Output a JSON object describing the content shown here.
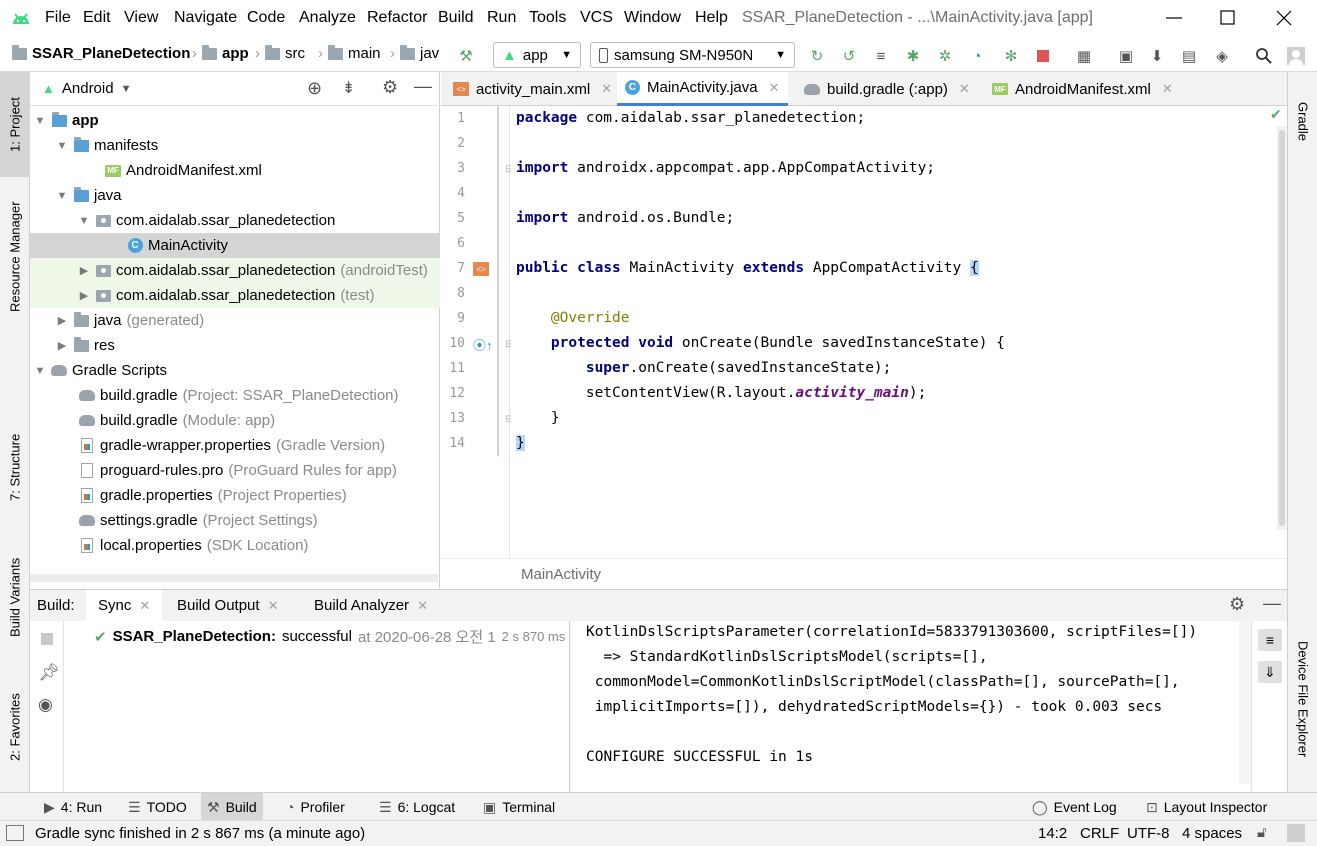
{
  "menu": {
    "items": [
      "File",
      "Edit",
      "View",
      "Navigate",
      "Code",
      "Analyze",
      "Refactor",
      "Build",
      "Run",
      "Tools",
      "VCS",
      "Window",
      "Help"
    ],
    "window_title": "SSAR_PlaneDetection - ...\\MainActivity.java [app]"
  },
  "nav": {
    "crumbs": [
      "SSAR_PlaneDetection",
      "app",
      "src",
      "main",
      "jav"
    ],
    "run_config": "app",
    "device": "samsung SM-N950N"
  },
  "left_strip": {
    "project": "1: Project",
    "resource_manager": "Resource Manager",
    "structure": "7: Structure",
    "build_variants": "Build Variants",
    "favorites": "2: Favorites"
  },
  "right_strip": {
    "gradle": "Gradle",
    "device_file_explorer": "Device File Explorer"
  },
  "project": {
    "view_mode": "Android",
    "tree": [
      {
        "label": "app",
        "muted": "",
        "bold": true
      },
      {
        "label": "manifests",
        "muted": ""
      },
      {
        "label": "AndroidManifest.xml",
        "muted": ""
      },
      {
        "label": "java",
        "muted": ""
      },
      {
        "label": "com.aidalab.ssar_planedetection",
        "muted": ""
      },
      {
        "label": "MainActivity",
        "muted": ""
      },
      {
        "label": "com.aidalab.ssar_planedetection",
        "muted": "(androidTest)"
      },
      {
        "label": "com.aidalab.ssar_planedetection",
        "muted": "(test)"
      },
      {
        "label": "java",
        "muted": "(generated)"
      },
      {
        "label": "res",
        "muted": ""
      },
      {
        "label": "Gradle Scripts",
        "muted": ""
      },
      {
        "label": "build.gradle",
        "muted": "(Project: SSAR_PlaneDetection)"
      },
      {
        "label": "build.gradle",
        "muted": "(Module: app)"
      },
      {
        "label": "gradle-wrapper.properties",
        "muted": "(Gradle Version)"
      },
      {
        "label": "proguard-rules.pro",
        "muted": "(ProGuard Rules for app)"
      },
      {
        "label": "gradle.properties",
        "muted": "(Project Properties)"
      },
      {
        "label": "settings.gradle",
        "muted": "(Project Settings)"
      },
      {
        "label": "local.properties",
        "muted": "(SDK Location)"
      }
    ]
  },
  "editor": {
    "tabs": [
      "activity_main.xml",
      "MainActivity.java",
      "build.gradle (:app)",
      "AndroidManifest.xml"
    ],
    "line_numbers": [
      "1",
      "2",
      "3",
      "4",
      "5",
      "6",
      "7",
      "8",
      "9",
      "10",
      "11",
      "12",
      "13",
      "14"
    ],
    "code": {
      "l1_kw": "package",
      "l1_rest": " com.aidalab.ssar_planedetection;",
      "l3_kw": "import",
      "l3_rest": " androidx.appcompat.app.AppCompatActivity;",
      "l5_kw": "import",
      "l5_rest": " android.os.Bundle;",
      "l7_kw1": "public",
      "l7_kw2": "class",
      "l7_name": " MainActivity ",
      "l7_kw3": "extends",
      "l7_rest": " AppCompatActivity ",
      "l7_brace": "{",
      "l9_ann": "@Override",
      "l10_kw1": "protected",
      "l10_kw2": "void",
      "l10_rest": " onCreate(Bundle savedInstanceState) {",
      "l11_kw": "super",
      "l11_rest": ".onCreate(savedInstanceState);",
      "l12_a": "setContentView(R.layout.",
      "l12_field": "activity_main",
      "l12_b": ");",
      "l13": "}",
      "l14": "}"
    },
    "breadcrumb": "MainActivity"
  },
  "build": {
    "label": "Build:",
    "tabs": [
      "Sync",
      "Build Output",
      "Build Analyzer"
    ],
    "result_name": "SSAR_PlaneDetection:",
    "result_status": "successful",
    "result_when": "at 2020-06-28 오전 1",
    "result_time": "2 s 870 ms",
    "output": [
      "KotlinDslScriptsParameter(correlationId=5833791303600, scriptFiles=[])",
      "  => StandardKotlinDslScriptsModel(scripts=[],",
      " commonModel=CommonKotlinDslScriptModel(classPath=[], sourcePath=[],",
      " implicitImports=[]), dehydratedScriptModels={}) - took 0.003 secs",
      "",
      "CONFIGURE SUCCESSFUL in 1s"
    ]
  },
  "bottom_tools": {
    "run": "4: Run",
    "todo": "TODO",
    "build": "Build",
    "profiler": "Profiler",
    "logcat": "6: Logcat",
    "terminal": "Terminal",
    "event_log": "Event Log",
    "layout_inspector": "Layout Inspector"
  },
  "status": {
    "message": "Gradle sync finished in 2 s 867 ms (a minute ago)",
    "position": "14:2",
    "line_sep": "CRLF",
    "encoding": "UTF-8",
    "indent": "4 spaces"
  },
  "colors": {
    "accent": "#4083c9",
    "android_green": "#3ddc84",
    "keyword": "#000080",
    "annotation": "#808000",
    "success": "#59a869",
    "stop": "#e05555"
  }
}
